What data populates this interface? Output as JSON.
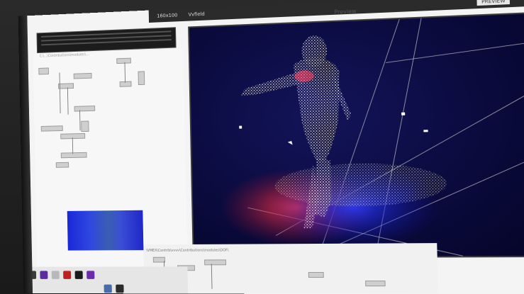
{
  "topbar": {
    "resolution": "160x100",
    "mode": "Vvfield",
    "corner_label": "PREVIEW"
  },
  "preview": {
    "title": "Preview"
  },
  "patch": {
    "path_top": "C:\\...\\Contributions\\modules\\...",
    "path_bottom": "\\VMEX\\Contrib\\vvvv\\Contributions\\modules\\DOF\\"
  },
  "colors": {
    "preview_bg": "#0a0a3c",
    "pointcloud": "#e8e4c8",
    "floor_red": "#d8253a",
    "floor_blue": "#2233e0"
  }
}
